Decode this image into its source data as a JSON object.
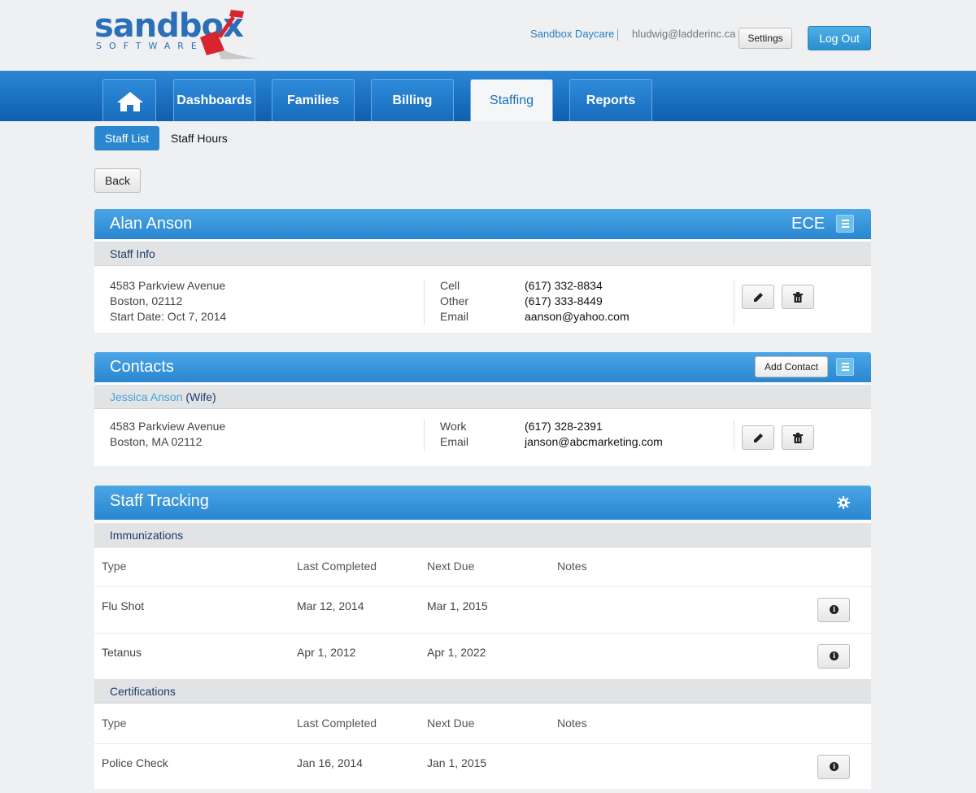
{
  "header": {
    "logo_text": "sandbox",
    "logo_sub": "SOFTWARE",
    "org_name": "Sandbox Daycare",
    "user_email": "hludwig@ladderinc.ca",
    "settings_label": "Settings",
    "logout_label": "Log Out"
  },
  "nav": {
    "tabs": [
      {
        "label": "Dashboards"
      },
      {
        "label": "Families"
      },
      {
        "label": "Billing"
      },
      {
        "label": "Staffing",
        "active": true
      },
      {
        "label": "Reports"
      }
    ]
  },
  "subnav": {
    "items": [
      {
        "label": "Staff List",
        "active": true
      },
      {
        "label": "Staff Hours"
      }
    ]
  },
  "back_label": "Back",
  "staff": {
    "name": "Alan Anson",
    "role": "ECE",
    "section_label": "Staff Info",
    "address_line1": "4583 Parkview Avenue",
    "address_line2": "Boston, 02112",
    "start_date": "Start Date: Oct 7, 2014",
    "phones": [
      {
        "label": "Cell",
        "value": "(617) 332-8834"
      },
      {
        "label": "Other",
        "value": "(617) 333-8449"
      },
      {
        "label": "Email",
        "value": "aanson@yahoo.com"
      }
    ]
  },
  "contacts": {
    "title": "Contacts",
    "add_label": "Add Contact",
    "items": [
      {
        "name": "Jessica Anson",
        "relation": "(Wife)",
        "address_line1": "4583 Parkview Avenue",
        "address_line2": "Boston, MA 02112",
        "phones": [
          {
            "label": "Work",
            "value": "(617) 328-2391"
          },
          {
            "label": "Email",
            "value": "janson@abcmarketing.com"
          }
        ]
      }
    ]
  },
  "tracking": {
    "title": "Staff Tracking",
    "immunizations": {
      "label": "Immunizations",
      "columns": [
        "Type",
        "Last Completed",
        "Next Due",
        "Notes"
      ],
      "rows": [
        {
          "type": "Flu Shot",
          "last": "Mar 12, 2014",
          "next": "Mar 1, 2015",
          "notes": ""
        },
        {
          "type": "Tetanus",
          "last": "Apr 1, 2012",
          "next": "Apr 1, 2022",
          "notes": ""
        }
      ]
    },
    "certifications": {
      "label": "Certifications",
      "columns": [
        "Type",
        "Last Completed",
        "Next Due",
        "Notes"
      ],
      "rows": [
        {
          "type": "Police Check",
          "last": "Jan 16, 2014",
          "next": "Jan 1, 2015",
          "notes": ""
        }
      ]
    }
  },
  "colors": {
    "brand_blue": "#2a6fb8",
    "nav_blue": "#1a6fc0",
    "logo_red": "#d9232e"
  }
}
